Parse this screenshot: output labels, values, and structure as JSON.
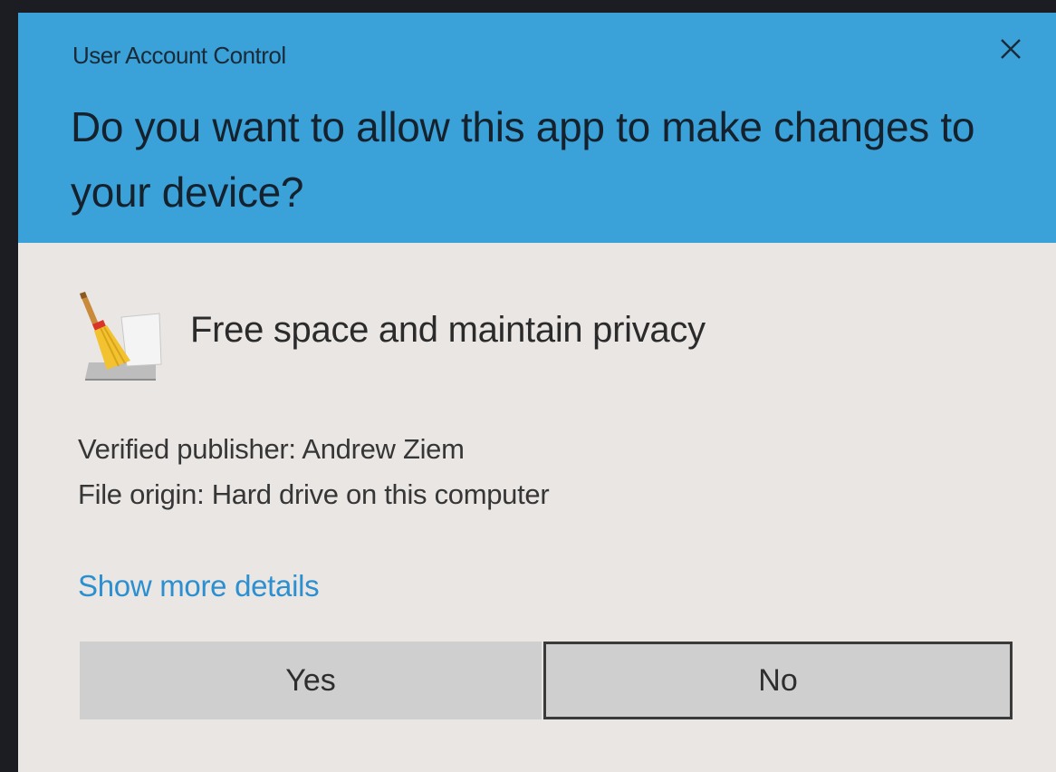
{
  "dialog": {
    "window_title": "User Account Control",
    "question": "Do you want to allow this app to make changes to your device?",
    "app_name": "Free space and maintain privacy",
    "app_icon": "broom-icon",
    "publisher": "Verified publisher: Andrew Ziem",
    "file_origin": "File origin: Hard drive on this computer",
    "details_link": "Show more details",
    "yes_label": "Yes",
    "no_label": "No",
    "close_icon": "close-icon"
  },
  "colors": {
    "header": "#3aa2d8",
    "body": "#eae6e4",
    "link": "#2b8fd0",
    "button": "#cfcfcf"
  }
}
